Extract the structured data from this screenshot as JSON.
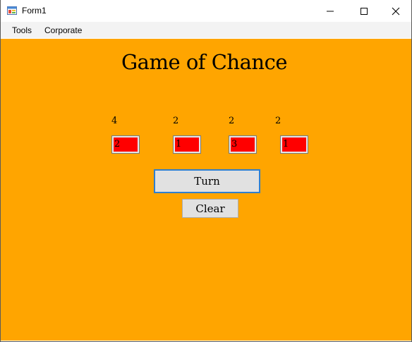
{
  "window": {
    "title": "Form1",
    "icon": "winforms-app-icon"
  },
  "menu": {
    "items": [
      "Tools",
      "Corporate"
    ]
  },
  "game": {
    "heading": "Game of Chance",
    "counts": [
      "4",
      "2",
      "2",
      "2"
    ],
    "dice": [
      "2",
      "1",
      "3",
      "1"
    ]
  },
  "buttons": {
    "turn": "Turn",
    "clear": "Clear"
  },
  "colors": {
    "background": "#FFA500",
    "die_fill": "#FF0000",
    "focus_border": "#2F7FCF"
  }
}
